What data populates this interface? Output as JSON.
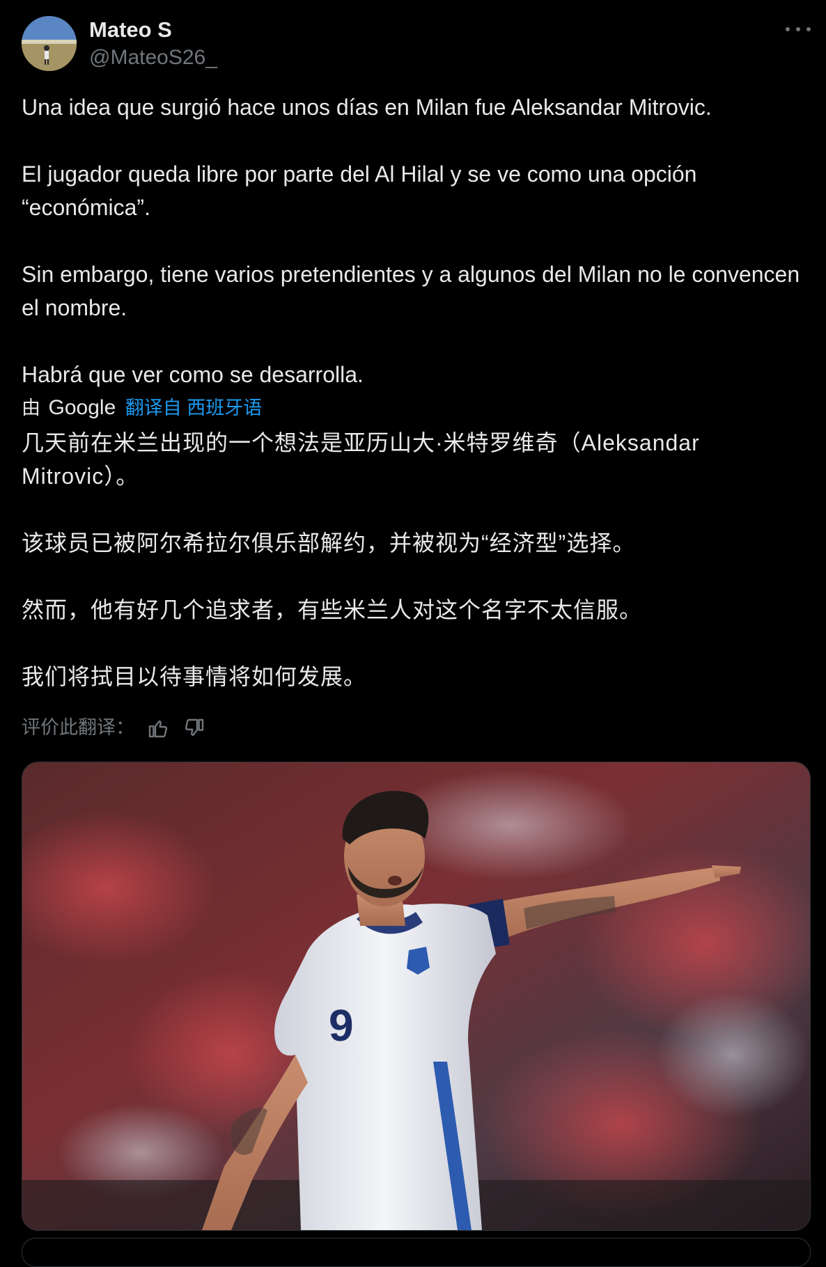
{
  "author": {
    "display_name": "Mateo S",
    "handle": "@MateoS26_",
    "avatar_icon": "avatar-photo"
  },
  "more_icon": "more-horizontal-icon",
  "tweet": {
    "paragraphs": [
      "Una idea que surgió hace unos días en Milan fue Aleksandar Mitrovic.",
      "El jugador queda libre por parte del Al Hilal y se ve como una opción “económica”.",
      "Sin embargo, tiene varios pretendientes y a algunos del Milan no le convencen el nombre.",
      "Habrá que ver como se desarrolla."
    ]
  },
  "translation": {
    "by_prefix": "由",
    "provider": "Google",
    "link_label": "翻译自 西班牙语",
    "paragraphs": [
      "几天前在米兰出现的一个想法是亚历山大·米特罗维奇（Aleksandar Mitrovic）。",
      "该球员已被阿尔希拉尔俱乐部解约，并被视为“经济型”选择。",
      "然而，他有好几个追求者，有些米兰人对这个名字不太信服。",
      "我们将拭目以待事情将如何发展。"
    ],
    "rate_label": "评价此翻译："
  },
  "media": {
    "jersey_number": "9",
    "description_icon": "player-photo"
  },
  "colors": {
    "background": "#000000",
    "text": "#e7e9ea",
    "secondary": "#71767b",
    "link": "#1d9bf0"
  }
}
